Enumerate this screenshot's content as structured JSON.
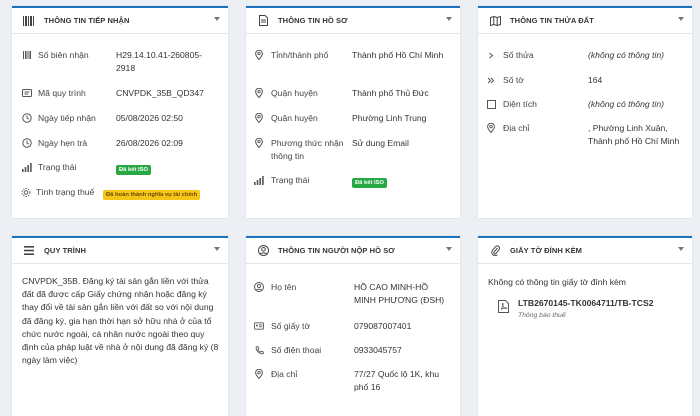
{
  "reception": {
    "title": "THÔNG TIN TIẾP NHẬN",
    "receipt_label": "Số biên nhận",
    "receipt_value": "H29.14.10.41-260805-2918",
    "process_code_label": "Mã quy trình",
    "process_code_value": "CNVPDK_35B_QD347",
    "received_date_label": "Ngày tiếp nhận",
    "received_date_value": "05/08/2026 02:50",
    "due_date_label": "Ngày hẹn trả",
    "due_date_value": "26/08/2026 02:09",
    "status_label": "Trạng thái",
    "status_value": "Đã kết ISO",
    "tax_label": "Tình trạng thuế",
    "tax_value": "Đã hoàn thành nghĩa vụ tài chính"
  },
  "dossier": {
    "title": "THÔNG TIN HỒ SƠ",
    "province_label": "Tỉnh/thành phố",
    "province_value": "Thành phố Hồ Chí Minh",
    "district_label": "Quận huyện",
    "district_value": "Thành phố Thủ Đức",
    "ward_label": "Quận huyện",
    "ward_value": "Phường Linh Trung",
    "receive_method_label": "Phương thức nhận thông tin",
    "receive_method_value": "Sử dung Email",
    "status_label": "Trạng thái",
    "status_value": "Đã kết ISO"
  },
  "parcel": {
    "title": "THÔNG TIN THỬA ĐẤT",
    "plot_label": "Số thửa",
    "plot_value": "(không có thông tin)",
    "sheet_label": "Số tờ",
    "sheet_value": "164",
    "area_label": "Diện tích",
    "area_value": "(không có thông tin)",
    "address_label": "Địa chỉ",
    "address_value": ", Phường Linh Xuân, Thành phố Hồ Chí Minh"
  },
  "procedure": {
    "title": "QUY TRÌNH",
    "text": "CNVPDK_35B. Đăng ký tài sản gắn liền với thửa đất đã được cấp Giấy chứng nhận hoặc đăng ký thay đổi về tài sản gắn liền với đất so với nội dung đã đăng ký, gia hạn thời hạn sở hữu nhà ở của tổ chức nước ngoài, cá nhân nước ngoài theo quy định của pháp luật về nhà ở nội dung đã đăng ký (8 ngày làm việc)"
  },
  "applicant": {
    "title": "THÔNG TIN NGƯỜI NỘP HỒ SƠ",
    "name_label": "Họ tên",
    "name_value": "HỒ CAO MINH-HỒ MINH PHƯƠNG (ĐSH)",
    "id_label": "Số giấy tờ",
    "id_value": "079087007401",
    "phone_label": "Số điện thoại",
    "phone_value": "0933045757",
    "address_label": "Địa chỉ",
    "address_value": "77/27 Quốc lộ 1K, khu phố 16"
  },
  "attachments": {
    "title": "GIẤY TỜ ĐÍNH KÈM",
    "empty_text": "Không có thông tin giấy tờ đính kèm",
    "file_name": "LTB2670145-TK0064711/TB-TCS2",
    "file_desc": "Thông báo thuế"
  },
  "colors": {
    "accent": "#1e73be",
    "badge_green": "#27a844",
    "badge_yellow": "#f5c518"
  }
}
